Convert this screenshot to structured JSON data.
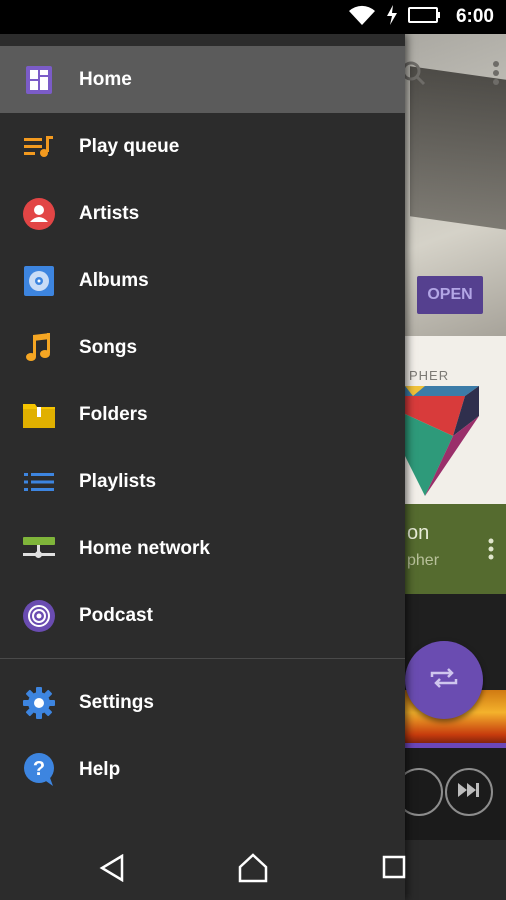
{
  "status_bar": {
    "time": "6:00",
    "icons": [
      "wifi-icon",
      "charging-icon",
      "battery-icon"
    ]
  },
  "drawer": {
    "items": [
      {
        "label": "Home",
        "icon": "home-icon",
        "selected": true,
        "color": "#7b5cc8"
      },
      {
        "label": "Play queue",
        "icon": "play-queue-icon",
        "color": "#f39a1f"
      },
      {
        "label": "Artists",
        "icon": "artist-icon",
        "color": "#e24545"
      },
      {
        "label": "Albums",
        "icon": "album-icon",
        "color": "#3d85e0"
      },
      {
        "label": "Songs",
        "icon": "music-note-icon",
        "color": "#f5a623"
      },
      {
        "label": "Folders",
        "icon": "folder-icon",
        "color": "#f5c400"
      },
      {
        "label": "Playlists",
        "icon": "list-icon",
        "color": "#3d85e0"
      },
      {
        "label": "Home network",
        "icon": "network-icon",
        "color": "#7fb53a"
      },
      {
        "label": "Podcast",
        "icon": "podcast-icon",
        "color": "#6a4cb1"
      }
    ],
    "footer_items": [
      {
        "label": "Settings",
        "icon": "gear-icon",
        "color": "#3d85e0"
      },
      {
        "label": "Help",
        "icon": "help-icon",
        "color": "#3d85e0"
      }
    ]
  },
  "background": {
    "open_label": "OPEN",
    "art_text": "PHER",
    "card_title": "on",
    "card_subtitle": "pher"
  },
  "nav_bar": {
    "icons": [
      "back-icon",
      "home-nav-icon",
      "recents-icon"
    ]
  }
}
